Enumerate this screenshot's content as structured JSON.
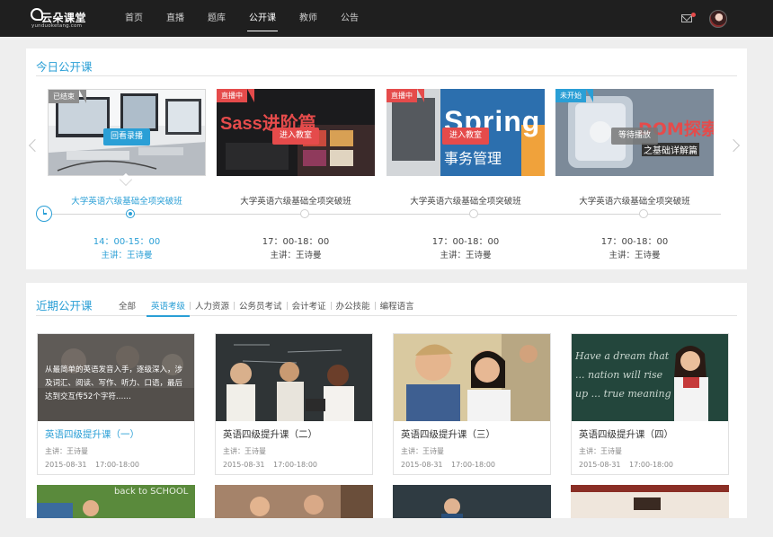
{
  "brand": {
    "name": "云朵课堂",
    "domain": "yunduoketang.com"
  },
  "nav": {
    "items": [
      {
        "label": "首页"
      },
      {
        "label": "直播"
      },
      {
        "label": "题库"
      },
      {
        "label": "公开课"
      },
      {
        "label": "教师"
      },
      {
        "label": "公告"
      }
    ],
    "active_index": 3
  },
  "today": {
    "title": "今日公开课",
    "lessons": [
      {
        "status": "已结束",
        "action": "回看录播",
        "name": "大学英语六级基础全项突破班",
        "time": "14：00-15：00",
        "teacher": "主讲：王诗曼",
        "active": true
      },
      {
        "status": "直播中",
        "action": "进入教室",
        "name": "大学英语六级基础全项突破班",
        "time": "17：00-18：00",
        "teacher": "主讲：王诗曼",
        "active": false,
        "cover_text": "Sass进阶篇"
      },
      {
        "status": "直播中",
        "action": "进入教室",
        "name": "大学英语六级基础全项突破班",
        "time": "17：00-18：00",
        "teacher": "主讲：王诗曼",
        "active": false,
        "cover_text": "Spring",
        "cover_subtext": "事务管理"
      },
      {
        "status": "未开始",
        "action": "等待播放",
        "name": "大学英语六级基础全项突破班",
        "time": "17：00-18：00",
        "teacher": "主讲：王诗曼",
        "active": false,
        "cover_text": "DOM探索",
        "cover_subtext": "之基础详解篇"
      }
    ]
  },
  "recent": {
    "title": "近期公开课",
    "tabs": [
      "全部",
      "英语考级",
      "人力资源",
      "公务员考试",
      "会计考证",
      "办公技能",
      "编程语言"
    ],
    "active_tab": 1,
    "courses": [
      {
        "title": "英语四级提升课（一）",
        "teacher": "主讲：王诗曼",
        "date": "2015-08-31",
        "time": "17:00-18:00",
        "description": "从最简单的英语发音入手，逐级深入，涉及词汇、阅读、写作、听力、口语，最后达到交互传52个字符……"
      },
      {
        "title": "英语四级提升课（二）",
        "teacher": "主讲：王诗曼",
        "date": "2015-08-31",
        "time": "17:00-18:00"
      },
      {
        "title": "英语四级提升课（三）",
        "teacher": "主讲：王诗曼",
        "date": "2015-08-31",
        "time": "17:00-18:00"
      },
      {
        "title": "英语四级提升课（四）",
        "teacher": "主讲：王诗曼",
        "date": "2015-08-31",
        "time": "17:00-18:00",
        "cover_text": "Have a dream that ... nation will rise up ... true meaning"
      }
    ],
    "row2_cover_text": "back to SCHOOL"
  },
  "colors": {
    "accent": "#2a9fd6",
    "live": "#e54b4b",
    "ended": "#8e8e8e",
    "topbar": "#1f1f1f"
  }
}
